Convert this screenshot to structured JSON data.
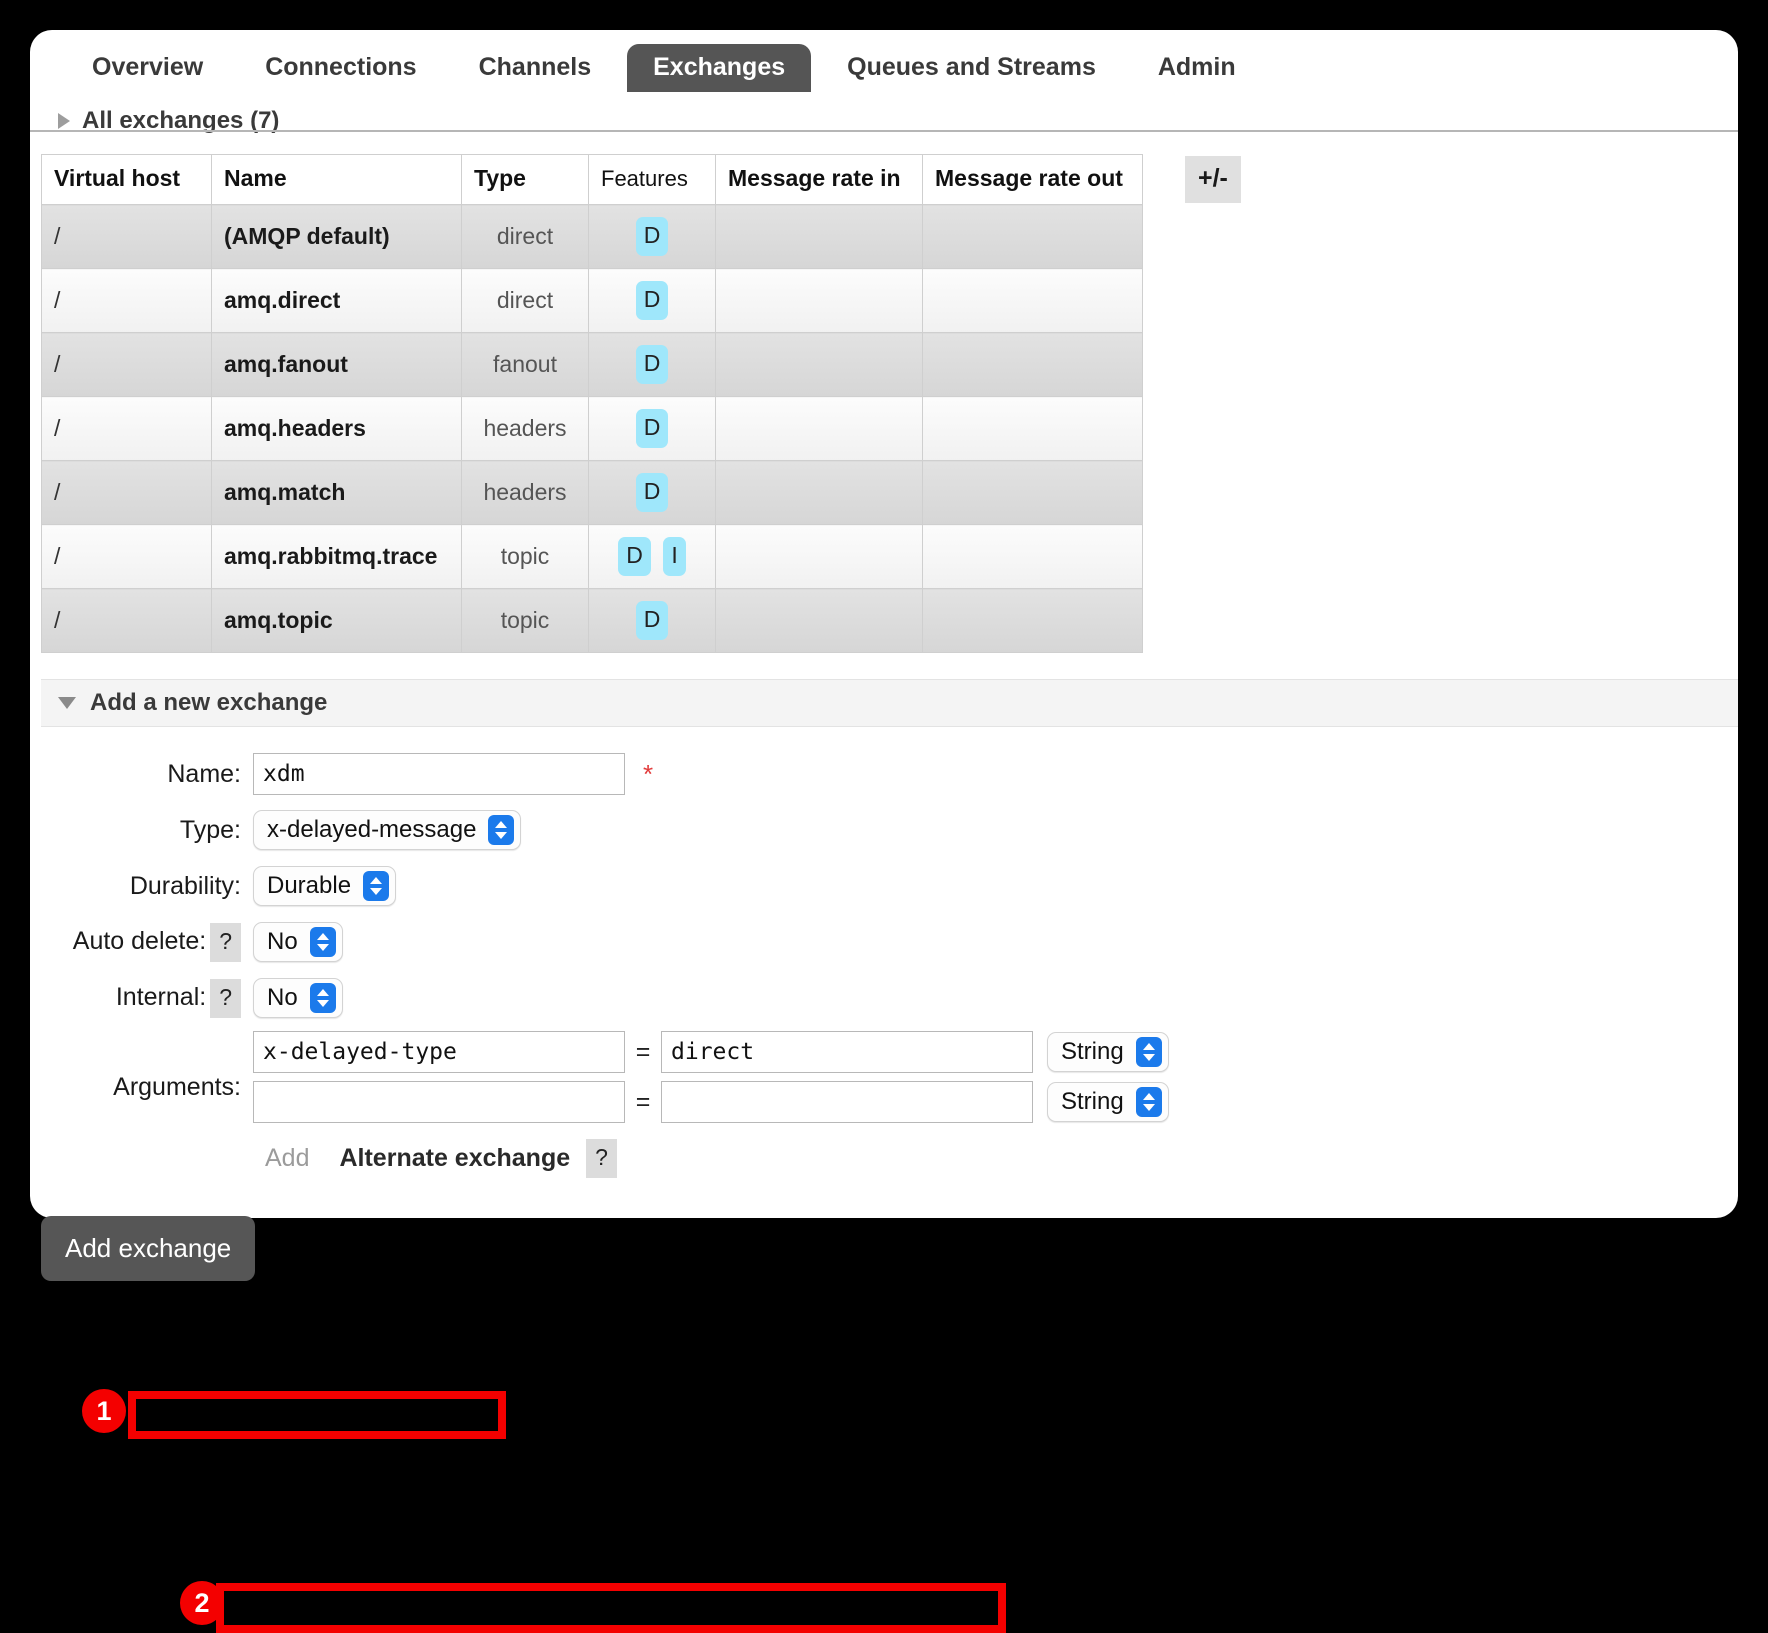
{
  "nav": {
    "tabs": [
      {
        "label": "Overview",
        "active": false
      },
      {
        "label": "Connections",
        "active": false
      },
      {
        "label": "Channels",
        "active": false
      },
      {
        "label": "Exchanges",
        "active": true
      },
      {
        "label": "Queues and Streams",
        "active": false
      },
      {
        "label": "Admin",
        "active": false
      }
    ]
  },
  "exchanges_section": {
    "heading": "All exchanges (7)",
    "columns_toggle": "+/-",
    "table": {
      "headers": [
        "Virtual host",
        "Name",
        "Type",
        "Features",
        "Message rate in",
        "Message rate out"
      ],
      "rows": [
        {
          "vhost": "/",
          "name": "(AMQP default)",
          "type": "direct",
          "features": [
            "D"
          ],
          "rate_in": "",
          "rate_out": ""
        },
        {
          "vhost": "/",
          "name": "amq.direct",
          "type": "direct",
          "features": [
            "D"
          ],
          "rate_in": "",
          "rate_out": ""
        },
        {
          "vhost": "/",
          "name": "amq.fanout",
          "type": "fanout",
          "features": [
            "D"
          ],
          "rate_in": "",
          "rate_out": ""
        },
        {
          "vhost": "/",
          "name": "amq.headers",
          "type": "headers",
          "features": [
            "D"
          ],
          "rate_in": "",
          "rate_out": ""
        },
        {
          "vhost": "/",
          "name": "amq.match",
          "type": "headers",
          "features": [
            "D"
          ],
          "rate_in": "",
          "rate_out": ""
        },
        {
          "vhost": "/",
          "name": "amq.rabbitmq.trace",
          "type": "topic",
          "features": [
            "D",
            "I"
          ],
          "rate_in": "",
          "rate_out": ""
        },
        {
          "vhost": "/",
          "name": "amq.topic",
          "type": "topic",
          "features": [
            "D"
          ],
          "rate_in": "",
          "rate_out": ""
        }
      ]
    }
  },
  "add_exchange": {
    "heading": "Add a new exchange",
    "name": {
      "label": "Name:",
      "value": "xdm",
      "required_marker": "*"
    },
    "type": {
      "label": "Type:",
      "value": "x-delayed-message"
    },
    "durability": {
      "label": "Durability:",
      "value": "Durable"
    },
    "auto_delete": {
      "label": "Auto delete:",
      "help": "?",
      "value": "No"
    },
    "internal": {
      "label": "Internal:",
      "help": "?",
      "value": "No"
    },
    "arguments": {
      "label": "Arguments:",
      "equals": "=",
      "rows": [
        {
          "key": "x-delayed-type",
          "value": "direct",
          "type": "String"
        },
        {
          "key": "",
          "value": "",
          "type": "String"
        }
      ],
      "add_link": "Add",
      "alternate_exchange": "Alternate exchange",
      "alternate_exchange_help": "?"
    },
    "submit_label": "Add exchange"
  },
  "annotations": [
    {
      "number": "1",
      "target": "type-row"
    },
    {
      "number": "2",
      "target": "arguments-first-row"
    }
  ],
  "colors": {
    "annotation_red": "#f40000",
    "active_tab_bg": "#555555",
    "feature_badge_bg": "#9fe7fb",
    "select_chevron_blue": "#1b7aeb",
    "submit_bg": "#565656"
  }
}
